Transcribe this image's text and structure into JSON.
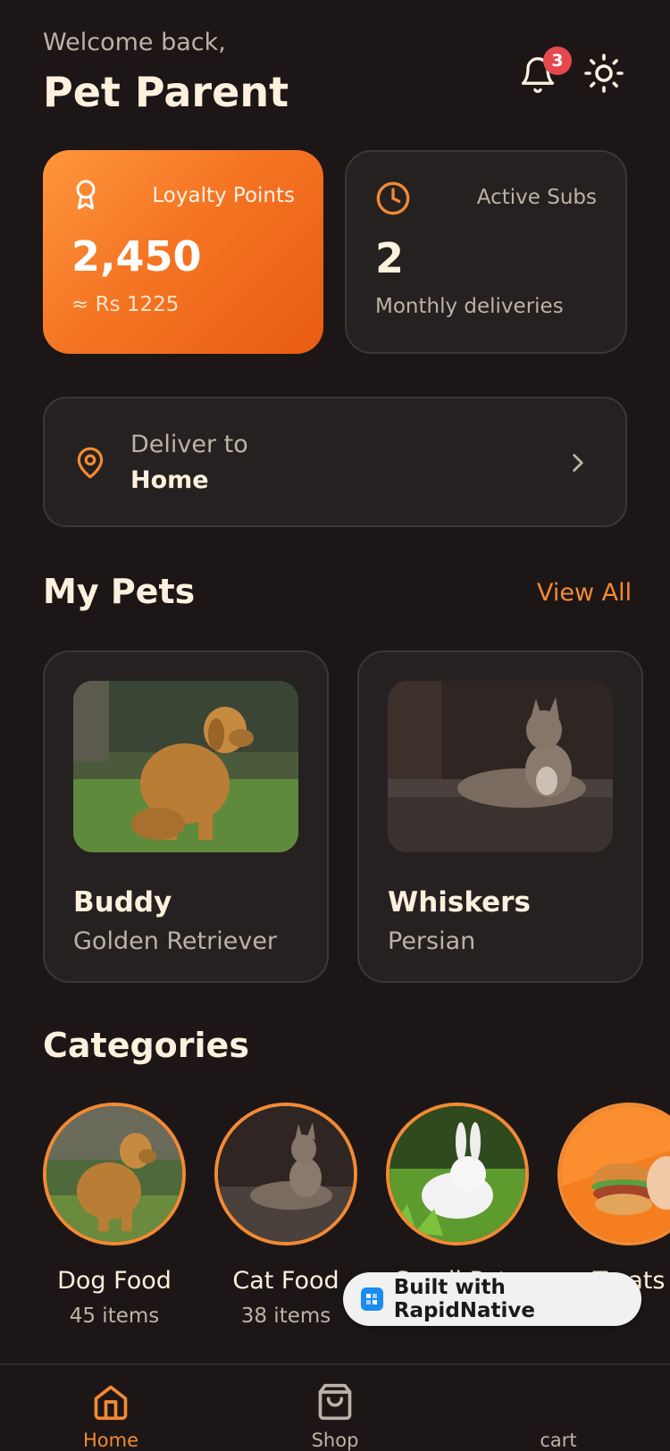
{
  "header": {
    "welcome": "Welcome back,",
    "user_name": "Pet Parent",
    "notification_count": "3"
  },
  "stats": {
    "loyalty": {
      "label": "Loyalty Points",
      "value": "2,450",
      "sub": "≈ Rs 1225"
    },
    "subs": {
      "label": "Active Subs",
      "value": "2",
      "sub": "Monthly deliveries"
    }
  },
  "delivery": {
    "label": "Deliver to",
    "address": "Home"
  },
  "pets_section": {
    "title": "My Pets",
    "view_all": "View All",
    "pets": [
      {
        "name": "Buddy",
        "breed": "Golden Retriever"
      },
      {
        "name": "Whiskers",
        "breed": "Persian"
      }
    ]
  },
  "categories_section": {
    "title": "Categories",
    "items": [
      {
        "name": "Dog Food",
        "count": "45 items"
      },
      {
        "name": "Cat Food",
        "count": "38 items"
      },
      {
        "name": "Small Pets",
        "count": ""
      },
      {
        "name": "Treats",
        "count": ""
      }
    ]
  },
  "badge": {
    "label": "Built with RapidNative"
  },
  "nav": {
    "items": [
      {
        "label": "Home",
        "icon": "home-icon",
        "active": true
      },
      {
        "label": "Shop",
        "icon": "shopping-bag-icon",
        "active": false
      },
      {
        "label": "cart",
        "icon": "cart-icon",
        "active": false
      }
    ]
  },
  "colors": {
    "background": "#1c1716",
    "card": "#252120",
    "accent": "#f28a35",
    "text": "#fdf1de",
    "muted": "#bdb2a6",
    "badge": "#e5484d"
  }
}
